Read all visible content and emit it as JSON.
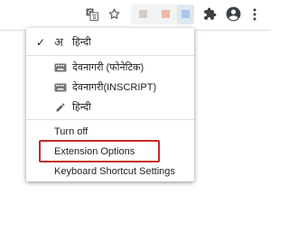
{
  "toolbar": {
    "icons": [
      "translate-icon",
      "star-icon",
      "extension-icon-1",
      "extension-icon-2",
      "extension-icon-3",
      "puzzle-icon",
      "profile-icon",
      "more-vert-icon"
    ],
    "colors": {
      "swatch1": "#d9ccc4",
      "swatch2": "#f1b8a8",
      "swatch3": "#a9c6ec",
      "swatch4": "#ddd3cc"
    }
  },
  "menu": {
    "languages": [
      {
        "icon": "check-icon",
        "glyph": "अ",
        "label": "हिन्दी",
        "selected": true
      },
      {
        "icon": "keyboard-icon",
        "label": "देवनागरी (फोनेटिक)"
      },
      {
        "icon": "keyboard-icon",
        "label": "देवनागरी(INSCRIPT)"
      },
      {
        "icon": "pencil-icon",
        "label": "हिन्दी"
      }
    ],
    "actions": {
      "turn_off": "Turn off",
      "extension_options": "Extension Options",
      "keyboard_shortcut_settings": "Keyboard Shortcut Settings"
    },
    "annotation_color": "#c62828"
  }
}
